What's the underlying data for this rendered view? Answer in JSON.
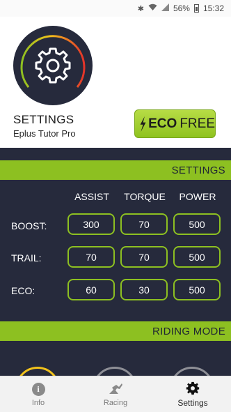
{
  "status_bar": {
    "icons": [
      "bluetooth-icon",
      "wifi-icon",
      "cell-signal-icon",
      "battery-icon"
    ],
    "battery": "56%",
    "time": "15:32"
  },
  "header": {
    "icon": "gear-icon",
    "title": "SETTINGS",
    "device": "Eplus Tutor Pro",
    "badge": {
      "bold": "ECO",
      "text": "FREE",
      "icon": "lightning-bolt-icon"
    }
  },
  "settings_section": {
    "title": "SETTINGS",
    "columns": [
      "ASSIST",
      "TORQUE",
      "POWER"
    ],
    "rows": [
      {
        "label": "BOOST:",
        "values": [
          "300",
          "70",
          "500"
        ]
      },
      {
        "label": "TRAIL:",
        "values": [
          "70",
          "70",
          "500"
        ]
      },
      {
        "label": "ECO:",
        "values": [
          "60",
          "30",
          "500"
        ]
      }
    ]
  },
  "riding_mode_section": {
    "title": "RIDING MODE"
  },
  "bottom_nav": {
    "items": [
      {
        "label": "Info",
        "icon": "info-icon",
        "active": false
      },
      {
        "label": "Racing",
        "icon": "racing-icon",
        "active": false
      },
      {
        "label": "Settings",
        "icon": "gear-icon",
        "active": true
      }
    ]
  },
  "colors": {
    "accent": "#8dc021",
    "panel": "#262a3c",
    "gauge_gradient": [
      "#8dc021",
      "#f2c21b",
      "#e3332a"
    ]
  }
}
